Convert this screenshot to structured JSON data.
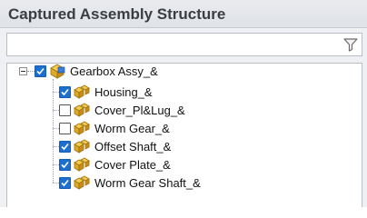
{
  "panel": {
    "title": "Captured Assembly Structure"
  },
  "filter": {
    "value": "",
    "placeholder": ""
  },
  "tree": {
    "root": {
      "label": "Gearbox Assy_&",
      "checked": true,
      "expanded": true
    },
    "children": [
      {
        "label": "Housing_&",
        "checked": true
      },
      {
        "label": "Cover_Pl&Lug_&",
        "checked": false
      },
      {
        "label": "Worm Gear_&",
        "checked": false
      },
      {
        "label": "Offset Shaft_&",
        "checked": true
      },
      {
        "label": "Cover Plate_&",
        "checked": true
      },
      {
        "label": "Worm Gear Shaft_&",
        "checked": true
      }
    ]
  }
}
